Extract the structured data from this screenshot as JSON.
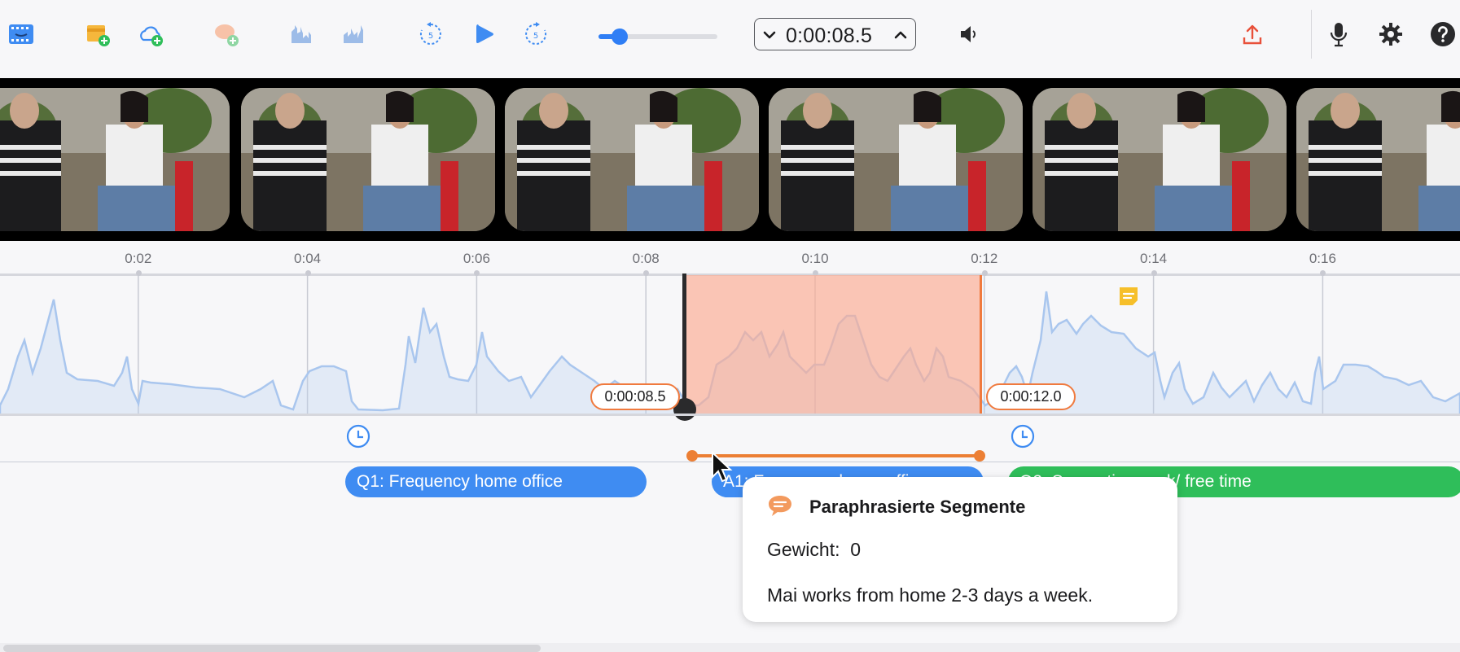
{
  "toolbar": {
    "timecode": "0:00:08.5",
    "playback_slider": {
      "value_percent": 18
    },
    "accent": "#2f7ef5",
    "icons": [
      "film-strip-icon",
      "add-folder-icon",
      "add-cloud-icon",
      "add-speech-bubble-icon",
      "waveform-icon",
      "waveform-edit-icon",
      "rewind-5-icon",
      "play-icon",
      "forward-5-icon",
      "speaker-icon",
      "upload-icon",
      "microphone-icon",
      "gear-icon",
      "help-icon"
    ]
  },
  "ruler": {
    "ticks": [
      {
        "label": "0:02",
        "t": 2
      },
      {
        "label": "0:04",
        "t": 4
      },
      {
        "label": "0:06",
        "t": 6
      },
      {
        "label": "0:08",
        "t": 8
      },
      {
        "label": "0:10",
        "t": 10
      },
      {
        "label": "0:12",
        "t": 12
      },
      {
        "label": "0:14",
        "t": 14
      },
      {
        "label": "0:16",
        "t": 16
      }
    ]
  },
  "selection": {
    "start_label": "0:00:08.5",
    "end_label": "0:00:12.0",
    "color": "#f07a3e"
  },
  "segments": [
    {
      "label": "Q1: Frequency home office",
      "color": "#3f8cf2"
    },
    {
      "label": "A1: Frequency home office",
      "color": "#3f8cf2"
    },
    {
      "label": "Q2: Separating work/ free time",
      "color": "#2fbe5a"
    }
  ],
  "tooltip": {
    "title": "Paraphrasierte Segmente",
    "weight_label": "Gewicht:",
    "weight_value": "0",
    "description": "Mai works from home 2-3 days a week."
  }
}
